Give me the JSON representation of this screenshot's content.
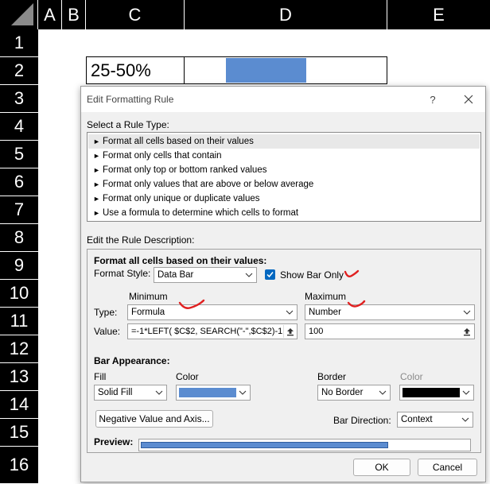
{
  "sheet": {
    "columns": [
      "A",
      "B",
      "C",
      "D",
      "E"
    ],
    "rows": [
      "1",
      "2",
      "3",
      "4",
      "5",
      "6",
      "7",
      "8",
      "9",
      "10",
      "11",
      "12",
      "13",
      "14",
      "15",
      "16"
    ],
    "c2_value": "25-50%",
    "d2_bar_fraction": 0.4
  },
  "dialog": {
    "title": "Edit Formatting Rule",
    "help": "?",
    "select_rule_type_label": "Select a Rule Type:",
    "rule_types": [
      "Format all cells based on their values",
      "Format only cells that contain",
      "Format only top or bottom ranked values",
      "Format only values that are above or below average",
      "Format only unique or duplicate values",
      "Use a formula to determine which cells to format"
    ],
    "selected_rule_index": 0,
    "edit_description_label": "Edit the Rule Description:",
    "description_heading": "Format all cells based on their values:",
    "format_style_label": "Format Style:",
    "format_style_value": "Data Bar",
    "show_bar_only_label": "Show Bar Only",
    "show_bar_only_checked": true,
    "minimum_label": "Minimum",
    "maximum_label": "Maximum",
    "type_label": "Type:",
    "value_label": "Value:",
    "min_type": "Formula",
    "max_type": "Number",
    "min_value": "=-1*LEFT( $C$2,  SEARCH(\"-\",$C$2)-1",
    "max_value": "100",
    "bar_appearance_label": "Bar Appearance:",
    "fill_label": "Fill",
    "fill_value": "Solid Fill",
    "color_label": "Color",
    "fill_color": "#5b8cd0",
    "border_label": "Border",
    "border_value": "No Border",
    "border_color_label": "Color",
    "border_color": "#000000",
    "negative_button": "Negative Value and Axis...",
    "bar_direction_label": "Bar Direction:",
    "bar_direction_value": "Context",
    "preview_label": "Preview:",
    "preview_fraction": 0.75,
    "ok": "OK",
    "cancel": "Cancel"
  }
}
